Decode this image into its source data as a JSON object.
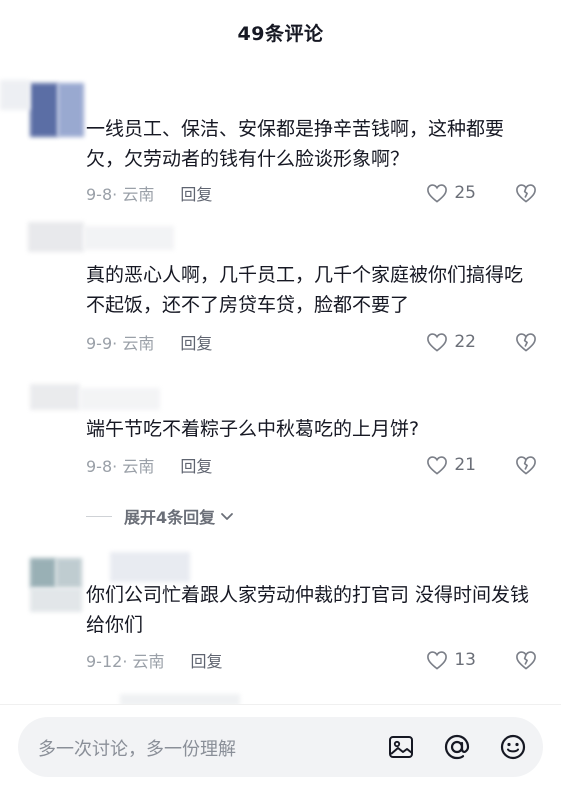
{
  "header": {
    "title": "49条评论"
  },
  "comments": [
    {
      "text": "一线员工、保洁、安保都是挣辛苦钱啊，这种都要欠，欠劳动者的钱有什么脸谈形象啊？",
      "date": "9-8",
      "location": "云南",
      "reply": "回复",
      "likes": "25"
    },
    {
      "text": "真的恶心人啊，几千员工，几千个家庭被你们搞得吃不起饭，还不了房贷车贷，脸都不要了",
      "date": "9-9",
      "location": "云南",
      "reply": "回复",
      "likes": "22"
    },
    {
      "text": "端午节吃不着粽子么中秋葛吃的上月饼?",
      "date": "9-8",
      "location": "云南",
      "reply": "回复",
      "likes": "21"
    },
    {
      "text": "你们公司忙着跟人家劳动仲裁的打官司 没得时间发钱给你们",
      "date": "9-12",
      "location": "云南",
      "reply": "回复",
      "likes": "13"
    }
  ],
  "expand_replies": "展开4条回复",
  "composer": {
    "placeholder": "多一次讨论，多一份理解"
  },
  "icons": {
    "like": "heart-outline-icon",
    "dislike": "broken-heart-icon",
    "image": "image-icon",
    "mention": "at-icon",
    "emoji": "smiley-icon",
    "chevron": "chevron-down-icon"
  }
}
